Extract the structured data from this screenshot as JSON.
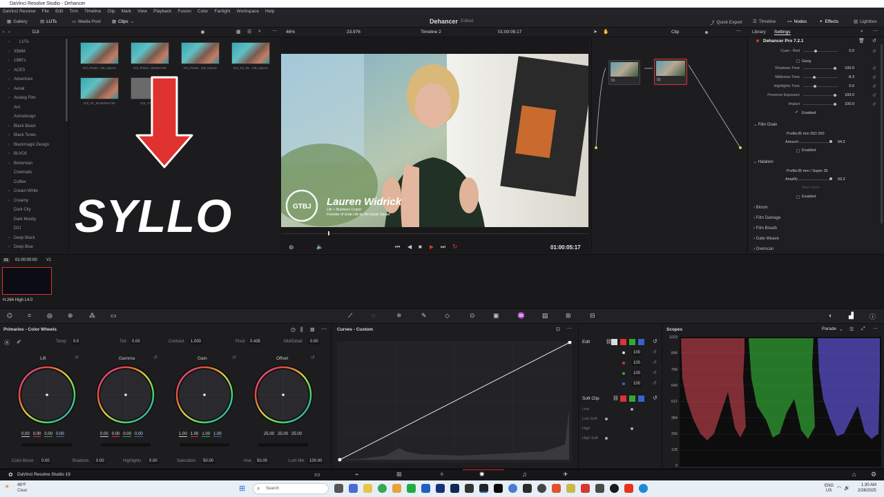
{
  "window": {
    "title": "DaVinci Resolve Studio - Dehancer"
  },
  "menu": [
    "DaVinci Resolve",
    "File",
    "Edit",
    "Trim",
    "Timeline",
    "Clip",
    "Mark",
    "View",
    "Playback",
    "Fusion",
    "Color",
    "Fairlight",
    "Workspace",
    "Help"
  ],
  "topbar": {
    "gallery": "Gallery",
    "luts": "LUTs",
    "media_pool": "Media Pool",
    "clips": "Clips",
    "project": "Dehancer",
    "edited": "Edited",
    "quick_export": "Quick Export",
    "timeline": "Timeline",
    "nodes": "Nodes",
    "effects": "Effects",
    "lightbox": "Lightbox"
  },
  "viewerbar": {
    "bin": "DJI",
    "zoom": "46%",
    "fps": "23.976",
    "timeline_name": "Timeline 2",
    "timecode": "01:00:05:17",
    "clip_mode": "Clip"
  },
  "luts": [
    "LUTs",
    "35MM",
    "1980's",
    "ACES",
    "Adventure",
    "Aerial",
    "Analog Film",
    "Arri",
    "Astrodesign",
    "Black Beast",
    "Black Tones",
    "Blackmagic Design",
    "BLVCK",
    "Bohemian",
    "Cinematic",
    "Coffee",
    "Cream White",
    "Creamy",
    "Dark City",
    "Dark Moody",
    "DCI",
    "Deep Black",
    "Deep Blue"
  ],
  "clips": [
    "DJI_Pisani...GB_Improv",
    "DJI_Pisani...0623ec709",
    "DJI_Pisani...GB_Improv",
    "DJI_XS_DL...GB_Improv",
    "DJI_XT_DL0623ec709",
    "DJI_XT_DL..."
  ],
  "overlay_text": "SYLLO",
  "video": {
    "name": "Lauren Widrick",
    "subtitle1": "Life + Business Coach",
    "subtitle2": "Founder of Grab Life by the Goals Squad",
    "logo": "GTBJ"
  },
  "transport": {
    "timecode": "01:00:05:17"
  },
  "nodes": [
    {
      "label": "01"
    },
    {
      "label": "02"
    }
  ],
  "right_panel": {
    "tabs": [
      "Library",
      "Settings"
    ],
    "plugin": "Dehancer Pro 7.2.1",
    "rows": [
      {
        "label": "Cyan - Red",
        "value": "0.0"
      },
      {
        "label": "Shadows Tone",
        "value": "100.0"
      },
      {
        "label": "Midtones Tone",
        "value": "-8.3"
      },
      {
        "label": "Highlights Tone",
        "value": "0.0"
      },
      {
        "label": "Preserve Exposure",
        "value": "100.0"
      },
      {
        "label": "Impact",
        "value": "100.0"
      }
    ],
    "gang": "Gang",
    "enabled": "Enabled",
    "film_grain": {
      "title": "Film Grain",
      "profile_label": "Profile",
      "profile": "35 mm ISO 250",
      "amount_label": "Amount",
      "amount": "54.2",
      "enabled": "Enabled"
    },
    "halation": {
      "title": "Halation",
      "profile_label": "Profile",
      "profile": "35 mm / Super 35",
      "amplify_label": "Amplify",
      "amplify": "53.2",
      "mask": "Mask Mode",
      "enabled": "Enabled"
    },
    "sections": [
      "Bloom",
      "Film Damage",
      "Film Breath",
      "Gate Weave",
      "Overscan"
    ]
  },
  "timeline": {
    "track_id": "01",
    "timecode": "01:00:00:00",
    "track": "V1",
    "codec": "H.264 High L4.0"
  },
  "primaries": {
    "title": "Primaries - Color Wheels",
    "temp_label": "Temp",
    "temp": "0.0",
    "tint_label": "Tint",
    "tint": "0.00",
    "contrast_label": "Contrast",
    "contrast": "1.000",
    "pivot_label": "Pivot",
    "pivot": "0.435",
    "middetail_label": "Mid/Detail",
    "middetail": "0.00",
    "wheels": [
      {
        "name": "Lift",
        "values": [
          "0.00",
          "0.00",
          "0.00",
          "0.00"
        ]
      },
      {
        "name": "Gamma",
        "values": [
          "0.00",
          "0.00",
          "0.00",
          "0.00"
        ]
      },
      {
        "name": "Gain",
        "values": [
          "1.00",
          "1.00",
          "1.00",
          "1.00"
        ]
      },
      {
        "name": "Offset",
        "values": [
          "25.00",
          "25.00",
          "25.00"
        ]
      }
    ],
    "bottom": [
      {
        "label": "Color Boost",
        "value": "0.00"
      },
      {
        "label": "Shadows",
        "value": "0.00"
      },
      {
        "label": "Highlights",
        "value": "0.00"
      },
      {
        "label": "Saturation",
        "value": "50.00"
      },
      {
        "label": "Hue",
        "value": "50.00"
      },
      {
        "label": "Lum Mix",
        "value": "100.00"
      }
    ]
  },
  "curves": {
    "title": "Curves - Custom"
  },
  "edit": {
    "title": "Edit",
    "values": [
      "100",
      "100",
      "100",
      "100"
    ],
    "soft_clip": "Soft Clip",
    "soft_labels": [
      "Low",
      "Low Soft",
      "High",
      "High Soft"
    ]
  },
  "scopes": {
    "title": "Scopes",
    "mode": "Parade",
    "ticks": [
      "1023",
      "896",
      "768",
      "640",
      "512",
      "384",
      "256",
      "128",
      "0"
    ]
  },
  "resolve_bar": {
    "label": "DaVinci Resolve Studio 19"
  },
  "taskbar": {
    "weather_temp": "49°F",
    "weather_desc": "Clear",
    "search": "Search",
    "lang1": "ENG",
    "lang2": "US",
    "time": "1:30 AM",
    "date": "2/28/2025"
  },
  "colors": {
    "accent_red": "#e0322e",
    "bg": "#1c1c1f"
  }
}
